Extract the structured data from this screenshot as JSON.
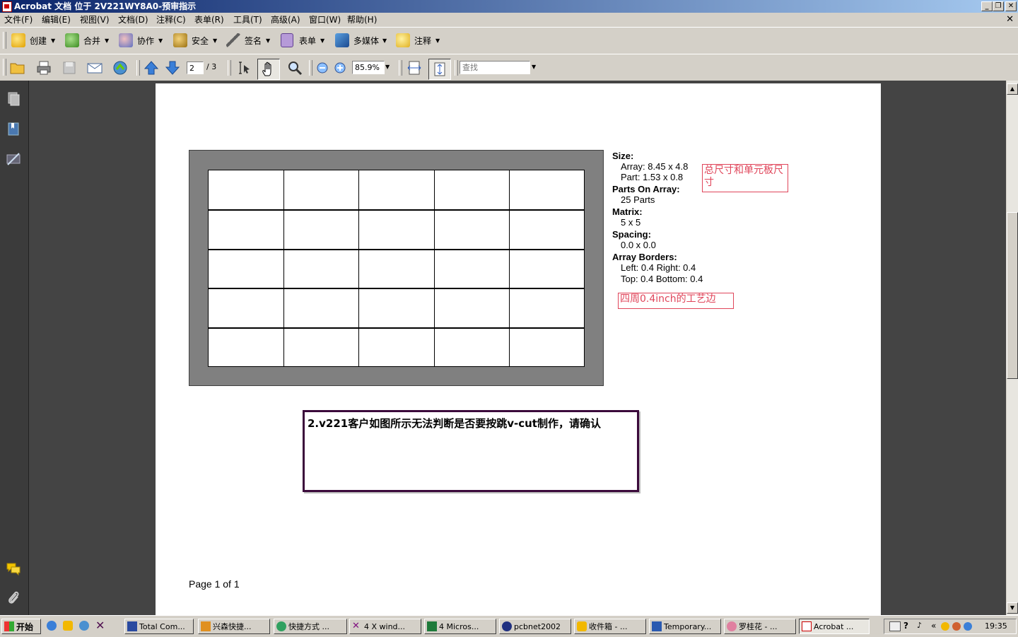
{
  "window": {
    "title": "Acrobat 文档 位于 2V221WY8A0-预审指示",
    "controls": [
      "_",
      "❐",
      "✕"
    ]
  },
  "menu": {
    "items": [
      "文件(F)",
      "编辑(E)",
      "视图(V)",
      "文档(D)",
      "注释(C)",
      "表单(R)",
      "工具(T)",
      "高级(A)",
      "窗口(W)",
      "帮助(H)"
    ],
    "close": "✕"
  },
  "toolbar1": {
    "items": [
      {
        "label": "创建",
        "icon": "create-icon"
      },
      {
        "label": "合并",
        "icon": "combine-icon"
      },
      {
        "label": "协作",
        "icon": "collaborate-icon"
      },
      {
        "label": "安全",
        "icon": "lock-icon"
      },
      {
        "label": "签名",
        "icon": "pen-icon"
      },
      {
        "label": "表单",
        "icon": "form-icon"
      },
      {
        "label": "多媒体",
        "icon": "multimedia-icon"
      },
      {
        "label": "注释",
        "icon": "comment-icon"
      }
    ]
  },
  "toolbar2": {
    "page_current": "2",
    "page_total": "/ 3",
    "zoom": "85.9%",
    "search_placeholder": "查找"
  },
  "document": {
    "specs": {
      "size_label": "Size:",
      "array_value": "Array: 8.45 x 4.8",
      "part_value": "Part: 1.53 x 0.8",
      "parts_label": "Parts On Array:",
      "parts_value": "25 Parts",
      "matrix_label": "Matrix:",
      "matrix_value": "5 x 5",
      "spacing_label": "Spacing:",
      "spacing_value": "0.0 x 0.0",
      "borders_label": "Array Borders:",
      "borders_lr": "Left: 0.4  Right: 0.4",
      "borders_tb": "Top: 0.4  Bottom: 0.4"
    },
    "array_matrix": {
      "rows": 5,
      "cols": 5
    },
    "note_size": "总尺寸和单元板尺寸",
    "note_border": "四周0.4inch的工艺边",
    "question": "2.v221客户如图所示无法判断是否要按跳v-cut制作，请确认",
    "page_footer": "Page 1 of 1"
  },
  "taskbar": {
    "start": "开始",
    "buttons": [
      "Total Com...",
      "兴森快捷...",
      "快捷方式 ...",
      "4 X wind...",
      "4 Micros...",
      "pcbnet2002",
      "收件箱 - ...",
      "Temporary...",
      "罗桂花 - ...",
      "Acrobat ..."
    ],
    "clock": "19:35"
  },
  "colors": {
    "annotation_red": "#e0455a",
    "doc_background": "#444444",
    "title_gradient_start": "#0a246a"
  }
}
